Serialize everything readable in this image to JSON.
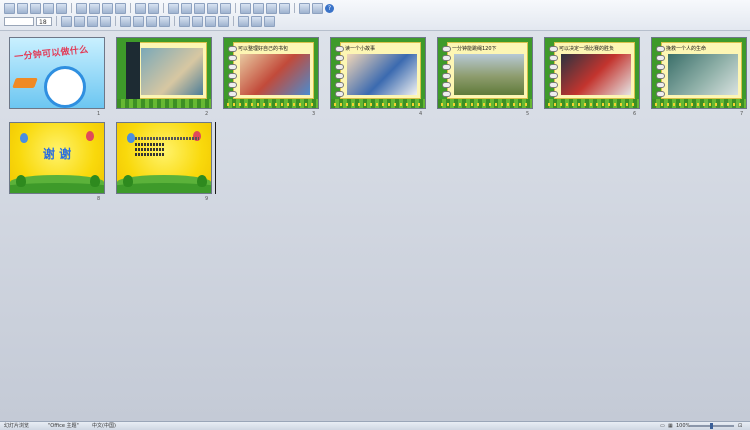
{
  "toolbar": {
    "font_size": "18",
    "zoom": "100%"
  },
  "slides": [
    {
      "num": "1",
      "title": "一分钟可以做什么"
    },
    {
      "num": "2",
      "title": ""
    },
    {
      "num": "3",
      "title": "可以整理好自己的书包"
    },
    {
      "num": "4",
      "title": "读一个小故事"
    },
    {
      "num": "5",
      "title": "一分钟能跳绳120下"
    },
    {
      "num": "6",
      "title": "可以决定一场比赛的胜负"
    },
    {
      "num": "7",
      "title": "挽救一个人的生命"
    },
    {
      "num": "8",
      "title": "谢 谢"
    },
    {
      "num": "9",
      "title": ""
    }
  ],
  "status": {
    "view": "幻灯片浏览",
    "theme": "\"Office 主题\"",
    "language": "中文(中国)",
    "zoom": "100%"
  },
  "colors": {
    "notebook_green": "#3e9a2a",
    "page_yellow": "#fdf6b4",
    "title_red": "#e23b57",
    "thanks_blue": "#2a6ee0"
  }
}
